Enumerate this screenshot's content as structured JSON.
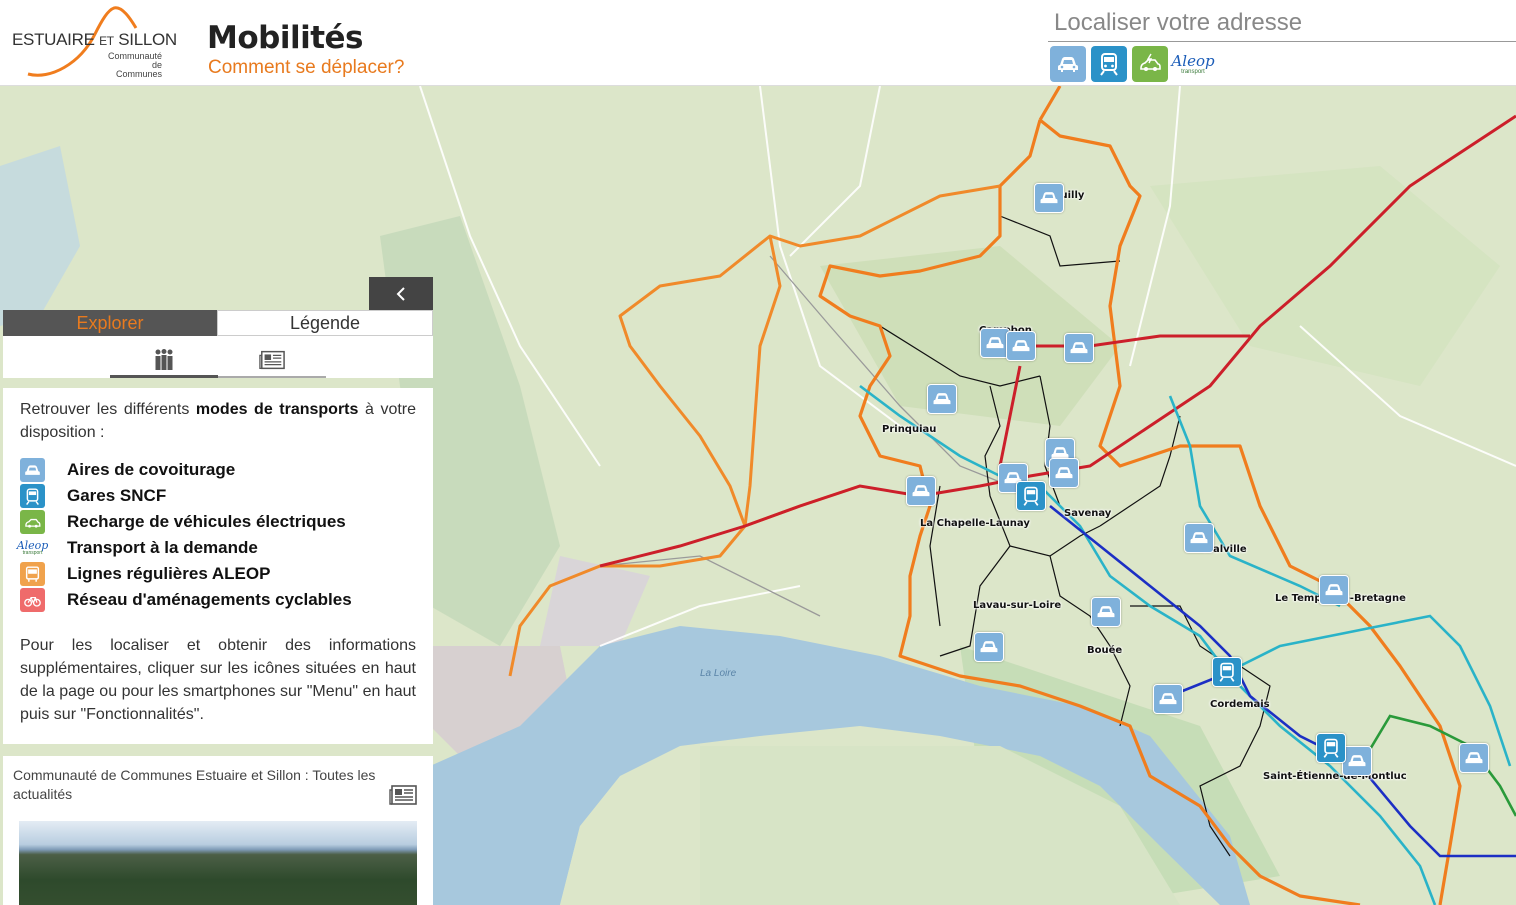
{
  "header": {
    "logo": {
      "line1a": "ESTUAIRE",
      "line1b": "ET",
      "line1c": "SILLON",
      "sub1": "Communauté",
      "sub2": "de Communes"
    },
    "title": "Mobilités",
    "subtitle": "Comment se déplacer?",
    "search_placeholder": "Localiser votre adresse"
  },
  "toolbar": {
    "buttons": [
      {
        "icon": "car-icon",
        "color": "#7fb1db"
      },
      {
        "icon": "train-icon",
        "color": "#2b92c8"
      },
      {
        "icon": "ev-charge-icon",
        "color": "#7ab648"
      },
      {
        "icon": "aleop-logo",
        "text": "Aleop",
        "sub": "transport"
      }
    ]
  },
  "map": {
    "places": [
      {
        "name": "Quilly"
      },
      {
        "name": "Campbon"
      },
      {
        "name": "Prinquiau"
      },
      {
        "name": "La Chapelle-Launay"
      },
      {
        "name": "Savenay"
      },
      {
        "name": "Malville"
      },
      {
        "name": "Le Temple-de-Bretagne"
      },
      {
        "name": "Lavau-sur-Loire"
      },
      {
        "name": "Bouée"
      },
      {
        "name": "Cordemais"
      },
      {
        "name": "Saint-Étienne-de-Montluc"
      }
    ],
    "river_label": "La Loire",
    "colors": {
      "boundary": "#f07d1e",
      "rail": "#cc1f2a",
      "aleop_line": "#2ab3c8",
      "bus_line": "#1c2fc4",
      "cycle": "#2a9a3a"
    }
  },
  "panel": {
    "tabs": [
      {
        "label": "Explorer"
      },
      {
        "label": "Légende"
      }
    ],
    "subtabs": [
      {
        "icon": "people-icon"
      },
      {
        "icon": "newspaper-icon"
      }
    ],
    "intro_pre": "Retrouver les différents ",
    "intro_bold": "modes de transports",
    "intro_post": " à votre disposition :",
    "legend": [
      {
        "label": "Aires de covoiturage",
        "icon": "car-icon",
        "color": "#7fb1db"
      },
      {
        "label": "Gares SNCF",
        "icon": "train-icon",
        "color": "#2b92c8"
      },
      {
        "label": "Recharge de véhicules électriques",
        "icon": "ev-charge-icon",
        "color": "#7ab648"
      },
      {
        "label": "Transport à la demande",
        "icon": "aleop-logo",
        "color": "#1a5cb8"
      },
      {
        "label": "Lignes régulières ALEOP",
        "icon": "bus-icon",
        "color": "#f0a24c"
      },
      {
        "label": "Réseau d'aménagements cyclables",
        "icon": "bike-icon",
        "color": "#ef6b6b"
      }
    ],
    "footnote": "Pour les localiser et obtenir des informations supplémentaires, cliquer sur les icônes situées en haut de la page ou pour les smartphones sur \"Menu\" en haut puis sur \"Fonctionnalités\".",
    "news_title": "Communauté de Communes Estuaire et Sillon : Toutes les actualités"
  }
}
